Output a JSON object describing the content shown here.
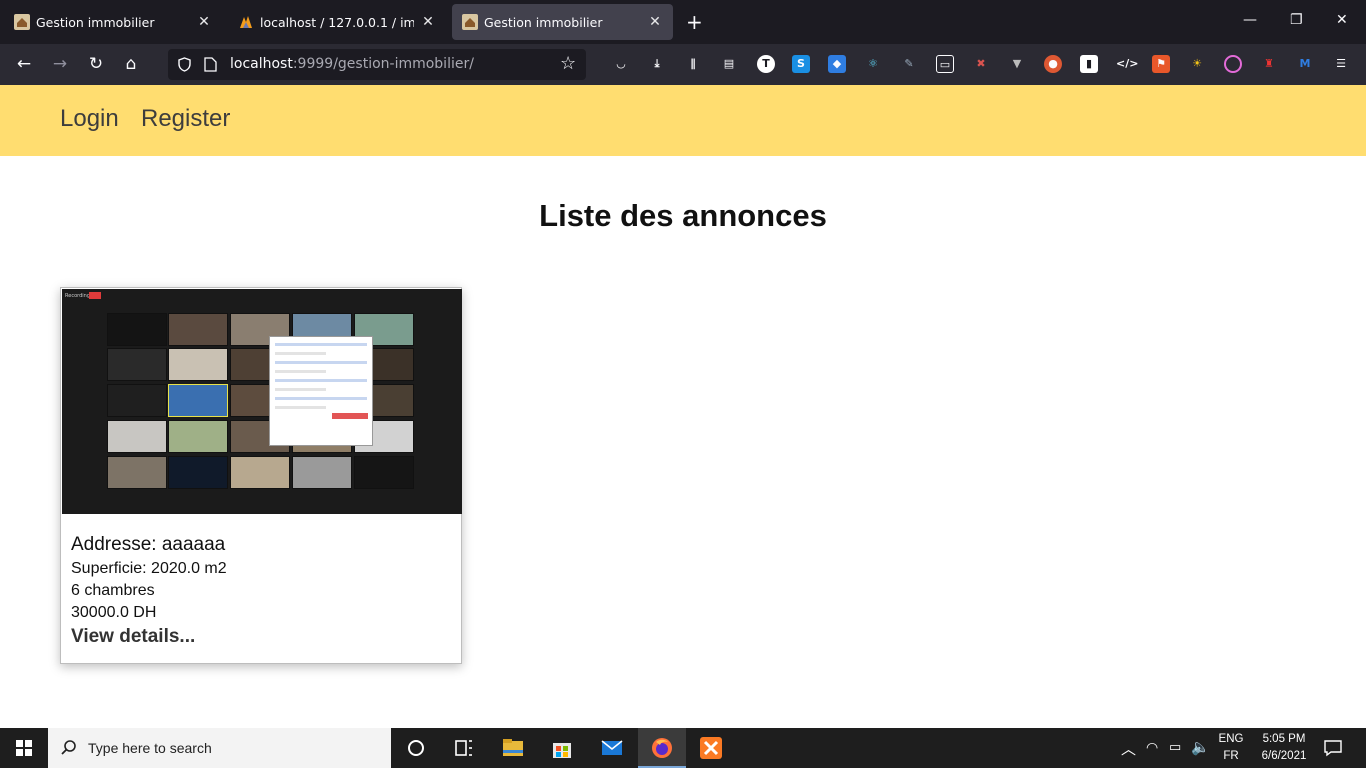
{
  "browser": {
    "tabs": [
      {
        "title": "Gestion immobilier",
        "active": false
      },
      {
        "title": "localhost / 127.0.0.1 / immobilier",
        "active": false
      },
      {
        "title": "Gestion immobilier",
        "active": true
      }
    ],
    "url_host": "localhost",
    "url_rest": ":9999/gestion-immobilier/"
  },
  "site": {
    "nav": {
      "login": "Login",
      "register": "Register"
    },
    "header_color": "#ffdd70",
    "page_title": "Liste des annonces"
  },
  "listing": {
    "image_label": "Recording",
    "address": "Addresse: aaaaaa",
    "superficie": "Superficie: 2020.0 m2",
    "rooms": "6 chambres",
    "price": "30000.0 DH",
    "details_link": "View details..."
  },
  "taskbar": {
    "search_placeholder": "Type here to search",
    "language": "ENG",
    "locale": "FR",
    "time": "5:05 PM",
    "date": "6/6/2021"
  }
}
